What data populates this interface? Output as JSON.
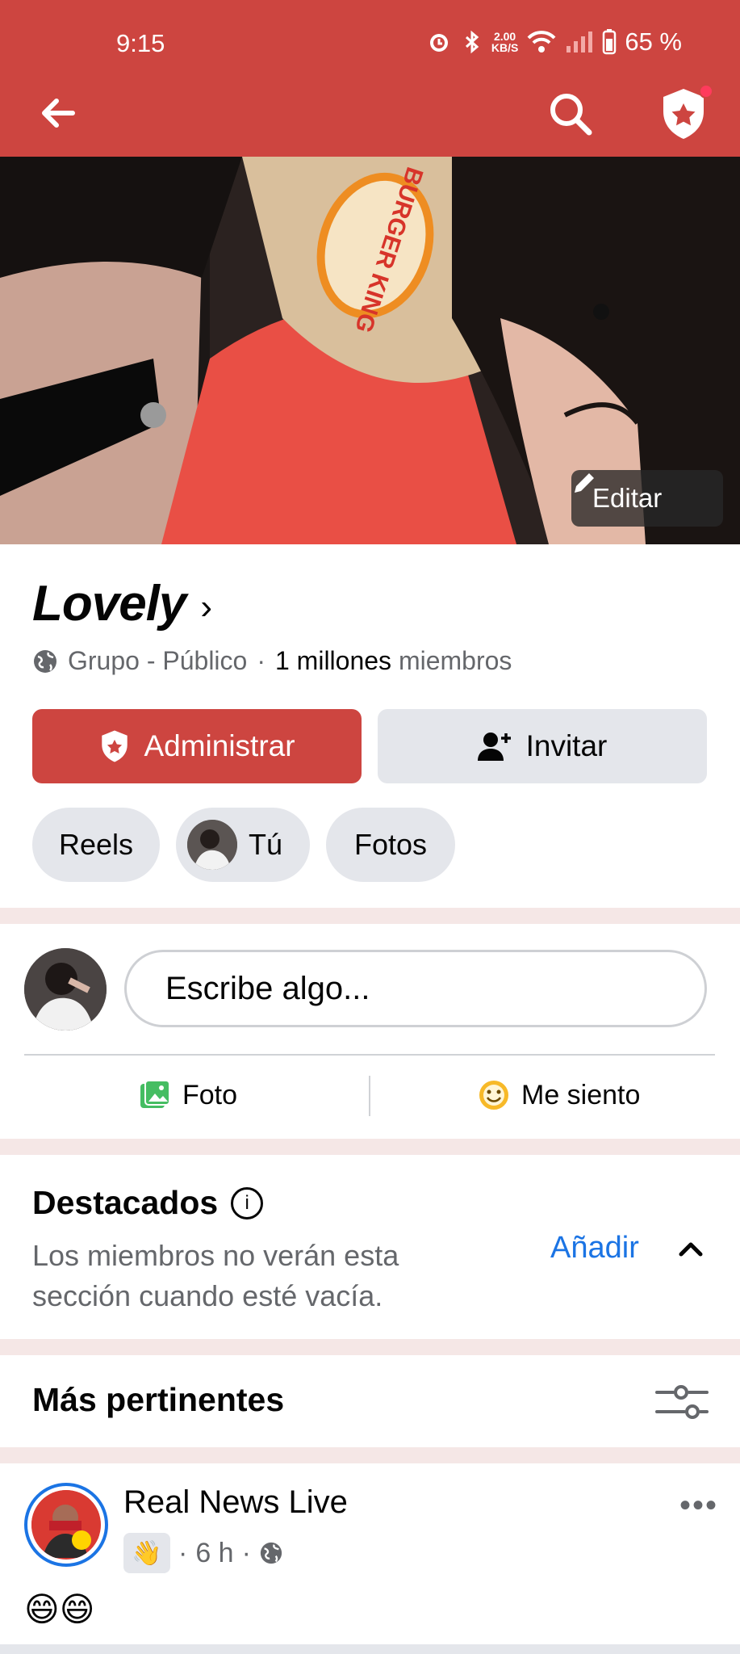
{
  "status_bar": {
    "time": "9:15",
    "net_speed": "2.00",
    "net_unit": "KB/S",
    "battery": "65 %"
  },
  "cover": {
    "edit_label": "Editar",
    "brand_text": "BURGER KING"
  },
  "group": {
    "name": "Lovely",
    "privacy": "Grupo - Público",
    "dot": "·",
    "members_count": "1 millones",
    "members_word": "miembros"
  },
  "actions": {
    "admin_label": "Administrar",
    "invite_label": "Invitar"
  },
  "chips": [
    {
      "label": "Reels"
    },
    {
      "label": "Tú"
    },
    {
      "label": "Fotos"
    }
  ],
  "composer": {
    "placeholder": "Escribe algo...",
    "photo_label": "Foto",
    "feeling_label": "Me siento"
  },
  "featured": {
    "title": "Destacados",
    "description": "Los miembros no verán esta sección cuando esté vacía.",
    "add_label": "Añadir"
  },
  "sort": {
    "title": "Más pertinentes"
  },
  "post": {
    "author": "Real News Live",
    "time": "6 h",
    "sep": "·",
    "more": "•••",
    "text": "😄😄",
    "reaction_emoji": "👋"
  },
  "colors": {
    "brand_red": "#cd4540",
    "link_blue": "#1b74e4",
    "secondary_text": "#65676b",
    "button_gray": "#e4e6eb"
  }
}
